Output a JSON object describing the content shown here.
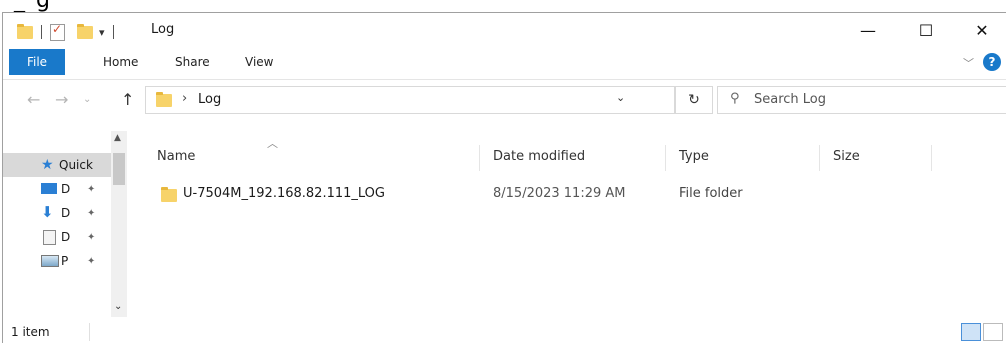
{
  "window": {
    "title": "Log",
    "title_fragment": "_ g"
  },
  "ribbon": {
    "tabs": [
      "File",
      "Home",
      "Share",
      "View"
    ],
    "help_label": "?"
  },
  "address": {
    "crumb_sep": "›",
    "crumb": "Log",
    "search_placeholder": "Search Log"
  },
  "navpane": {
    "items": [
      {
        "label": "Quick",
        "icon": "star-icon"
      },
      {
        "label": "D",
        "icon": "desktop-icon"
      },
      {
        "label": "D",
        "icon": "download-icon"
      },
      {
        "label": "D",
        "icon": "document-icon"
      },
      {
        "label": "P",
        "icon": "pictures-icon"
      }
    ]
  },
  "columns": {
    "name": "Name",
    "date": "Date modified",
    "type": "Type",
    "size": "Size"
  },
  "files": [
    {
      "name": "U-7504M_192.168.82.111_LOG",
      "date": "8/15/2023 11:29 AM",
      "type": "File folder",
      "size": ""
    }
  ],
  "status": {
    "count": "1 item"
  },
  "colors": {
    "accent": "#1979ca",
    "folder": "#f7d36a"
  }
}
